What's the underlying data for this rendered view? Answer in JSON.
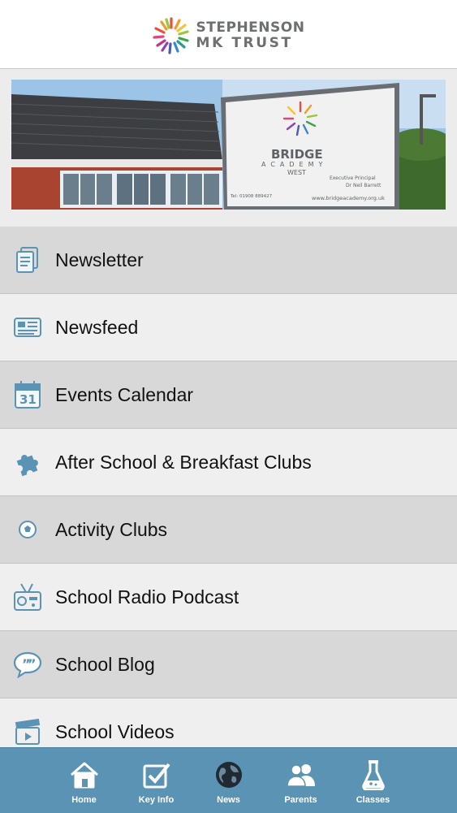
{
  "header": {
    "logo_line1": "STEPHENSON",
    "logo_line2": "MK TRUST"
  },
  "banner": {
    "sign_name": "BRIDGE",
    "sign_sub": "ACADEMY",
    "sign_sub2": "WEST",
    "sign_role": "Executive Principal",
    "sign_person": "Dr Neil Barrett",
    "sign_tel": "Tel: 01908 889427",
    "sign_web": "www.bridgeacademy.org.uk"
  },
  "menu": {
    "items": [
      {
        "label": "Newsletter",
        "icon": "document-icon"
      },
      {
        "label": "Newsfeed",
        "icon": "newspaper-icon"
      },
      {
        "label": "Events Calendar",
        "icon": "calendar-icon"
      },
      {
        "label": "After School & Breakfast Clubs",
        "icon": "puzzle-icon"
      },
      {
        "label": "Activity Clubs",
        "icon": "football-icon"
      },
      {
        "label": "School Radio Podcast",
        "icon": "radio-icon"
      },
      {
        "label": "School Blog",
        "icon": "speech-bubble-icon"
      },
      {
        "label": "School Videos",
        "icon": "clapperboard-icon"
      }
    ]
  },
  "calendar_day": "31",
  "tabbar": {
    "tabs": [
      {
        "label": "Home",
        "icon": "home-icon"
      },
      {
        "label": "Key Info",
        "icon": "checkbox-icon"
      },
      {
        "label": "News",
        "icon": "globe-icon",
        "active": true
      },
      {
        "label": "Parents",
        "icon": "people-icon"
      },
      {
        "label": "Classes",
        "icon": "flask-icon"
      }
    ]
  },
  "colors": {
    "tabbar": "#5a93b3",
    "icon_blue": "#5a93b3",
    "menu_dark": "#d8d8d8",
    "menu_light": "#efefef"
  }
}
